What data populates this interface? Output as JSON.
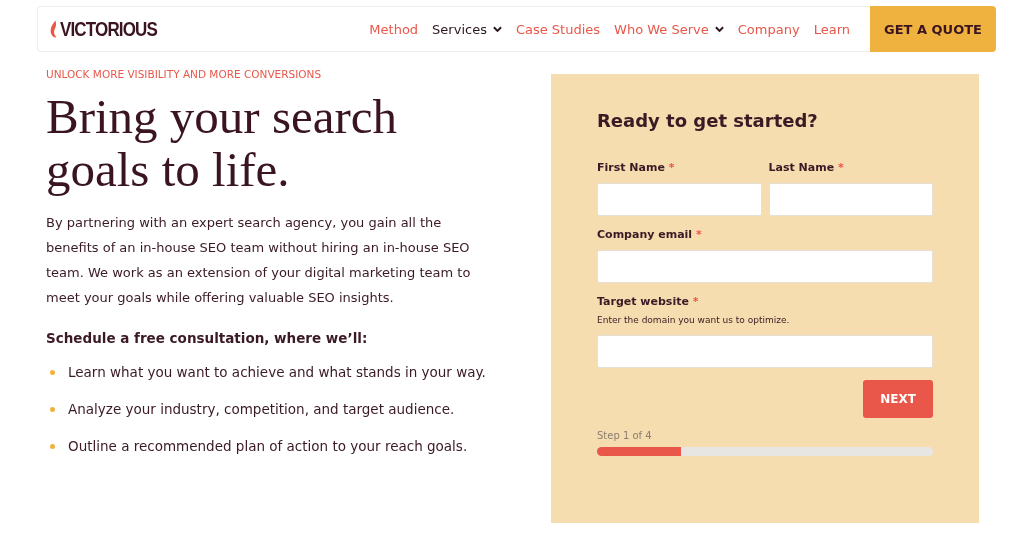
{
  "header": {
    "logo": "VICTORIOUS",
    "nav": [
      {
        "label": "Method",
        "selected": false,
        "dropdown": false
      },
      {
        "label": "Services",
        "selected": true,
        "dropdown": true
      },
      {
        "label": "Case Studies",
        "selected": false,
        "dropdown": false
      },
      {
        "label": "Who We Serve",
        "selected": false,
        "dropdown": true
      },
      {
        "label": "Company",
        "selected": false,
        "dropdown": false
      },
      {
        "label": "Learn",
        "selected": false,
        "dropdown": false
      }
    ],
    "cta": "GET A QUOTE"
  },
  "hero": {
    "eyebrow": "UNLOCK MORE VISIBILITY AND MORE CONVERSIONS",
    "title": "Bring your search goals to life.",
    "body": "By partnering with an expert search agency, you gain all the benefits of an in-house SEO team without hiring an in-house SEO team. We work as an extension of your digital marketing team to meet your goals while offering valuable SEO insights.",
    "list_heading": "Schedule a free consultation, where we’ll:",
    "bullets": [
      "Learn what you want to achieve and what stands in your way.",
      "Analyze your industry, competition, and target audience.",
      "Outline a recommended plan of action to your reach goals."
    ]
  },
  "form": {
    "title": "Ready to get started?",
    "rows": [
      [
        {
          "label": "First Name",
          "required": "*"
        },
        {
          "label": "Last Name",
          "required": "*"
        }
      ],
      [
        {
          "label": "Company email",
          "required": "*"
        }
      ],
      [
        {
          "label": "Target website",
          "required": "*",
          "hint": "Enter the domain you want us to optimize."
        }
      ]
    ],
    "next": "NEXT",
    "step": "Step 1 of 4",
    "progress": {
      "level": 0.25
    }
  }
}
